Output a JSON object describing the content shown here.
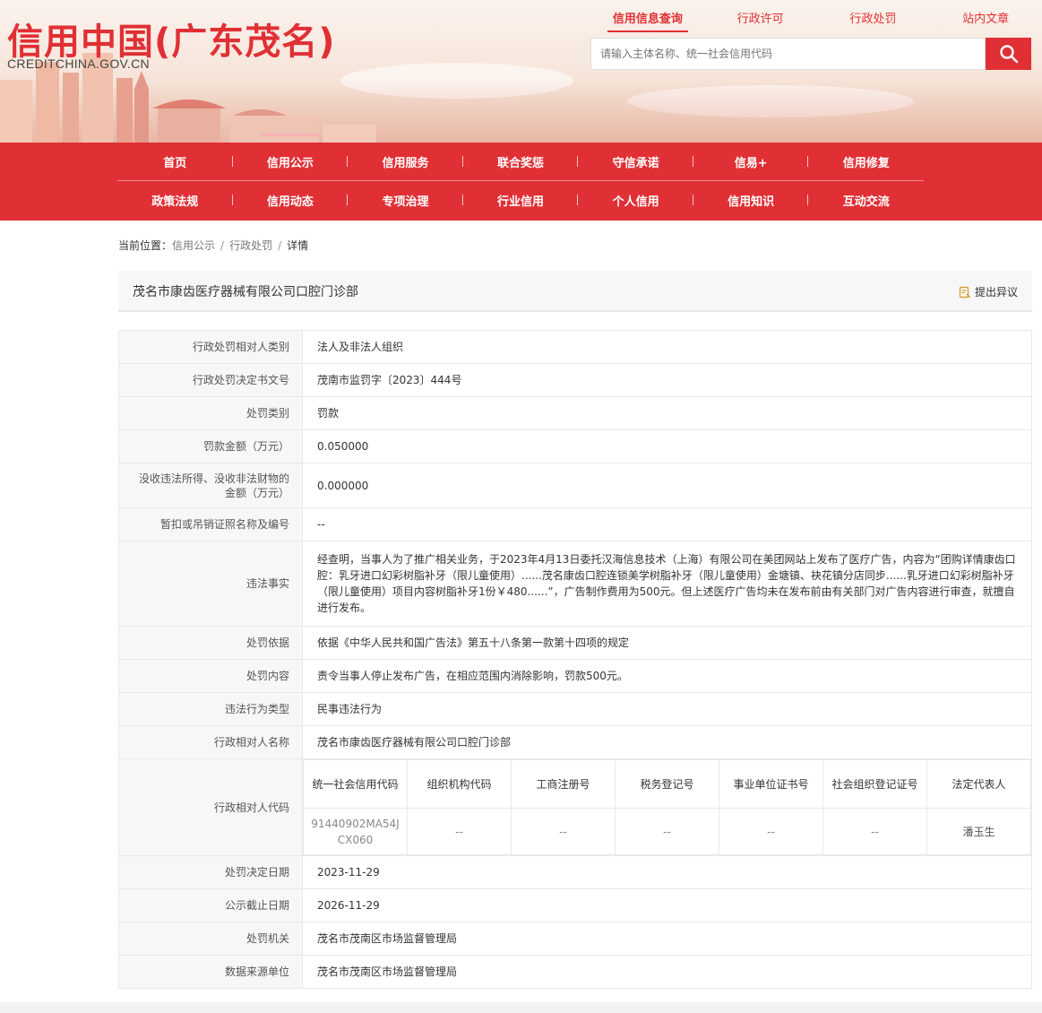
{
  "header": {
    "logo_title": "信用中国(广东茂名)",
    "logo_sub": "CREDITCHINA.GOV.CN",
    "top_links": [
      "信用信息查询",
      "行政许可",
      "行政处罚",
      "站内文章"
    ],
    "search_placeholder": "请输入主体名称、统一社会信用代码",
    "accent_color": "#e03035"
  },
  "nav": {
    "row1": [
      "首页",
      "信用公示",
      "信用服务",
      "联合奖惩",
      "守信承诺",
      "信易+",
      "信用修复"
    ],
    "row2": [
      "政策法规",
      "信用动态",
      "专项治理",
      "行业信用",
      "个人信用",
      "信用知识",
      "互动交流"
    ]
  },
  "breadcrumb": {
    "prefix": "当前位置：",
    "items": [
      "信用公示",
      "行政处罚",
      "详情"
    ],
    "sep": "/"
  },
  "title": {
    "text": "茂名市康齿医疗器械有限公司口腔门诊部",
    "objection": "提出异议"
  },
  "rows": [
    {
      "label": "行政处罚相对人类别",
      "value": "法人及非法人组织"
    },
    {
      "label": "行政处罚决定书文号",
      "value": "茂南市监罚字〔2023〕444号"
    },
    {
      "label": "处罚类别",
      "value": "罚款"
    },
    {
      "label": "罚款金额（万元）",
      "value": "0.050000"
    },
    {
      "label": "没收违法所得、没收非法财物的金额（万元）",
      "value": "0.000000"
    },
    {
      "label": "暂扣或吊销证照名称及编号",
      "value": "--"
    },
    {
      "label": "违法事实",
      "value": "经查明，当事人为了推广相关业务，于2023年4月13日委托汉海信息技术（上海）有限公司在美团网站上发布了医疗广告，内容为“团购详情康齿口腔：乳牙进口幻彩树脂补牙（限儿童使用）......茂名康齿口腔连锁美学树脂补牙（限儿童使用）金塘镇、袂花镇分店同步......乳牙进口幻彩树脂补牙（限儿童使用）项目内容树脂补牙1份￥480......”，广告制作费用为500元。但上述医疗广告均未在发布前由有关部门对广告内容进行审查，就擅自进行发布。"
    },
    {
      "label": "处罚依据",
      "value": "依据《中华人民共和国广告法》第五十八条第一款第十四项的规定"
    },
    {
      "label": "处罚内容",
      "value": "责令当事人停止发布广告，在相应范围内消除影响，罚款500元。"
    },
    {
      "label": "违法行为类型",
      "value": "民事违法行为"
    },
    {
      "label": "行政相对人名称",
      "value": "茂名市康齿医疗器械有限公司口腔门诊部"
    }
  ],
  "code_row": {
    "label": "行政相对人代码",
    "headers": [
      "统一社会信用代码",
      "组织机构代码",
      "工商注册号",
      "税务登记号",
      "事业单位证书号",
      "社会组织登记证号",
      "法定代表人"
    ],
    "values": [
      "91440902MA54JCX060",
      "--",
      "--",
      "--",
      "--",
      "--",
      "潘玉生"
    ]
  },
  "rows_after": [
    {
      "label": "处罚决定日期",
      "value": "2023-11-29"
    },
    {
      "label": "公示截止日期",
      "value": "2026-11-29"
    },
    {
      "label": "处罚机关",
      "value": "茂名市茂南区市场监督管理局"
    },
    {
      "label": "数据来源单位",
      "value": "茂名市茂南区市场监督管理局"
    }
  ]
}
